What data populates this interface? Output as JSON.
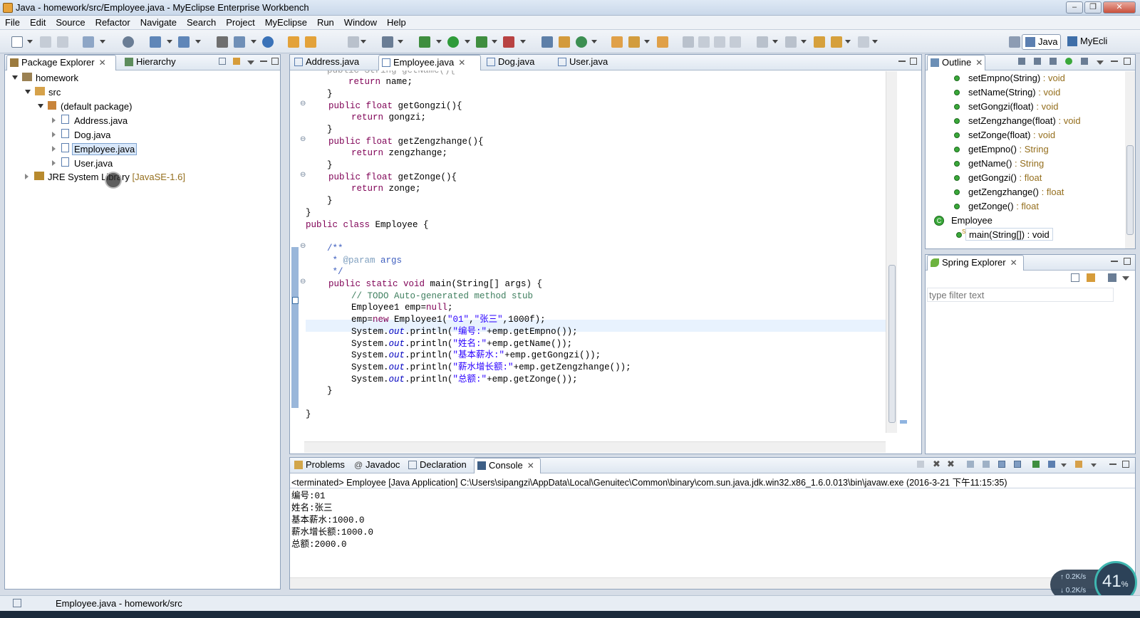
{
  "window": {
    "title": "Java - homework/src/Employee.java - MyEclipse Enterprise Workbench"
  },
  "menu": [
    "File",
    "Edit",
    "Source",
    "Refactor",
    "Navigate",
    "Search",
    "Project",
    "MyEclipse",
    "Run",
    "Window",
    "Help"
  ],
  "perspectives": {
    "java": "Java",
    "myeclipse": "MyEcli"
  },
  "package_explorer": {
    "tab_label": "Package Explorer",
    "hierarchy_label": "Hierarchy",
    "tree": {
      "project": "homework",
      "src": "src",
      "package": "(default package)",
      "files": [
        "Address.java",
        "Dog.java",
        "Employee.java",
        "User.java"
      ],
      "jre": "JRE System Library",
      "jre_version": "[JavaSE-1.6]"
    }
  },
  "editor": {
    "tabs": [
      "Address.java",
      "Employee.java",
      "Dog.java",
      "User.java"
    ],
    "active_tab": "Employee.java",
    "code": {
      "l0": "    public String getName(){",
      "l1_a": "        ",
      "l1_kw": "return",
      "l1_b": " name;",
      "l2": "    }",
      "l3_kw": "public float",
      "l3_b": " getGongzi(){",
      "l4_kw": "return",
      "l4_b": " gongzi;",
      "l5": "    }",
      "l6_kw": "public float",
      "l6_b": " getZengzhange(){",
      "l7_kw": "return",
      "l7_b": " zengzhange;",
      "l8": "    }",
      "l9_kw": "public float",
      "l9_b": " getZonge(){",
      "l10_kw": "return",
      "l10_b": " zonge;",
      "l11": "    }",
      "l12": "}",
      "l13_kw": "public class",
      "l13_b": " Employee {",
      "l15": "    /**",
      "l16_a": "     * ",
      "l16_tag": "@param",
      "l16_b": " args",
      "l17": "     */",
      "l18_kw": "public static void",
      "l18_b": " main(String[] args) {",
      "l19": "// TODO Auto-generated method stub",
      "l20_a": "Employee1 emp=",
      "l20_kw": "null",
      "l20_b": ";",
      "l21_a": "emp=",
      "l21_kw": "new",
      "l21_b": " Employee1(",
      "l21_s1": "\"01\"",
      "l21_c": ",",
      "l21_s2": "\"张三\"",
      "l21_d": ",1000f);",
      "p1_s": "\"编号:\"",
      "p1_b": "+emp.getEmpno());",
      "p2_s": "\"姓名:\"",
      "p2_b": "+emp.getName());",
      "p3_s": "\"基本薪水:\"",
      "p3_b": "+emp.getGongzi());",
      "p4_s": "\"薪水增长额:\"",
      "p4_b": "+emp.getZengzhange());",
      "p5_s": "\"总额:\"",
      "p5_b": "+emp.getZonge());",
      "sys_a": "System.",
      "sys_out": "out",
      "sys_b": ".println(",
      "l27": "    }",
      "l29": "}"
    }
  },
  "outline": {
    "tab_label": "Outline",
    "items": [
      {
        "name": "setEmpno(String)",
        "ret": " : void"
      },
      {
        "name": "setName(String)",
        "ret": " : void"
      },
      {
        "name": "setGongzi(float)",
        "ret": " : void"
      },
      {
        "name": "setZengzhange(float)",
        "ret": " : void"
      },
      {
        "name": "setZonge(float)",
        "ret": " : void"
      },
      {
        "name": "getEmpno()",
        "ret": " : String"
      },
      {
        "name": "getName()",
        "ret": " : String"
      },
      {
        "name": "getGongzi()",
        "ret": " : float"
      },
      {
        "name": "getZengzhange()",
        "ret": " : float"
      },
      {
        "name": "getZonge()",
        "ret": " : float"
      }
    ],
    "class_name": "Employee",
    "main_method": "main(String[]) : void",
    "static_marker": "S"
  },
  "spring_explorer": {
    "tab_label": "Spring Explorer",
    "filter_placeholder": "type filter text"
  },
  "bottom_panel": {
    "tabs": [
      "Problems",
      "Javadoc",
      "Declaration",
      "Console"
    ],
    "active_tab": "Console",
    "terminated": "<terminated> Employee [Java Application] C:\\Users\\sipangzi\\AppData\\Local\\Genuitec\\Common\\binary\\com.sun.java.jdk.win32.x86_1.6.0.013\\bin\\javaw.exe (2016-3-21 下午11:15:35)",
    "output": [
      "编号:01",
      "姓名:张三",
      "基本薪水:1000.0",
      "薪水增长额:1000.0",
      "总额:2000.0"
    ]
  },
  "status": {
    "path": "Employee.java - homework/src"
  },
  "netmeter": {
    "up": "0.2K/s",
    "down": "0.2K/s",
    "percent": "41",
    "percent_sign": "%"
  },
  "colors": {
    "keyword": "#7f0055",
    "string": "#2a00ff",
    "comment": "#3f7f5f",
    "javadoc": "#3f5fbf",
    "field": "#0000c0"
  }
}
